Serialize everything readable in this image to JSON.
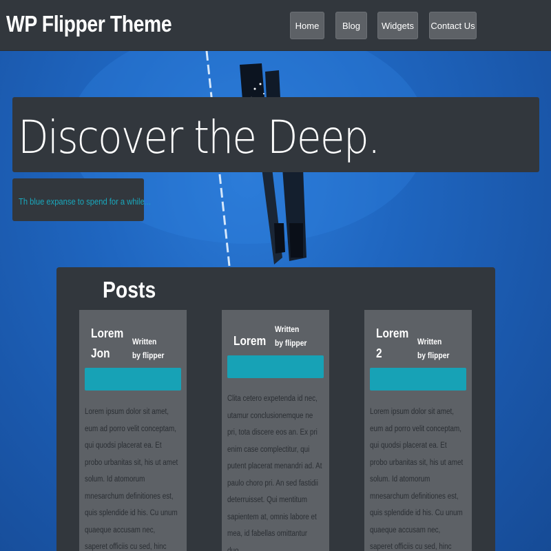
{
  "header": {
    "site_title": "WP Flipper Theme",
    "nav": [
      {
        "label": "Home"
      },
      {
        "label": "Blog"
      },
      {
        "label": "Widgets"
      },
      {
        "label": "Contact Us"
      }
    ]
  },
  "hero": {
    "title": "Discover the Deep.",
    "subtitle": "Th blue expanse to spend for a while..."
  },
  "posts": {
    "heading": "Posts",
    "items": [
      {
        "title_line1": "Lorem",
        "title_line2": "Jon",
        "meta_line1": "Written",
        "meta_line2": "by flipper",
        "body": "Lorem ipsum dolor sit amet, eum ad porro velit conceptam, qui quodsi placerat ea. Et probo urbanitas sit, his ut amet solum. Id atomorum mnesarchum definitiones est, quis splendide id his. Cu unum quaeque accusam nec, saperet officiis cu sed, hinc iisque detracto eos an."
      },
      {
        "title_line1": "Lorem",
        "title_line2": "",
        "meta_line1": "Written",
        "meta_line2": "by flipper",
        "body": "Clita cetero expetenda id nec, utamur conclusionemque ne pri, tota discere eos an. Ex pri enim case complectitur, qui putent placerat menandri ad. At paulo choro pri. An sed fastidii deterruisset. Qui mentitum sapientem at, omnis labore et mea, id fabellas omittantur duo."
      },
      {
        "title_line1": "Lorem",
        "title_line2": "2",
        "meta_line1": "Written",
        "meta_line2": "by flipper",
        "body": "Lorem ipsum dolor sit amet, eum ad porro velit conceptam, qui quodsi placerat ea. Et probo urbanitas sit, his ut amet solum. Id atomorum mnesarchum definitiones est, quis splendide id his. Cu unum quaeque accusam nec, saperet officiis cu sed, hinc iisque detracto eos an."
      }
    ]
  },
  "colors": {
    "panel": "#32373d",
    "card": "#5d6166",
    "accent": "#17a2b6",
    "subtitle": "#19a8bd",
    "ocean": "#1f63b8"
  }
}
